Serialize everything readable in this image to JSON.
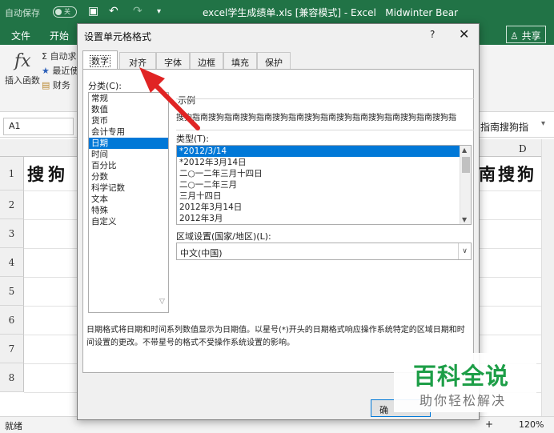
{
  "excel": {
    "autosave_label": "自动保存",
    "autosave_state": "关",
    "window_title": "excel学生成绩单.xls  [兼容模式]  -  Excel",
    "user_name": "Midwinter Bear",
    "ribbon_tabs": [
      "文件",
      "开始"
    ],
    "share_label": "共享",
    "insert_function_label": "插入函数",
    "autosum_label": "自动求",
    "recent_label": "最近使",
    "finance_label": "财务",
    "name_box_value": "A1",
    "formula_right_text": "指南搜狗指",
    "column_d": "D",
    "row_numbers": [
      "1",
      "2",
      "3",
      "4",
      "5",
      "6",
      "7",
      "8"
    ],
    "cell_left_text": "搜狗",
    "cell_right_text": "南搜狗",
    "status_text": "就绪",
    "zoom": "120%"
  },
  "dialog": {
    "title": "设置单元格格式",
    "help": "?",
    "close": "✕",
    "tabs": [
      "数字",
      "对齐",
      "字体",
      "边框",
      "填充",
      "保护"
    ],
    "active_tab": "数字",
    "category_label": "分类(C):",
    "categories": [
      "常规",
      "数值",
      "货币",
      "会计专用",
      "日期",
      "时间",
      "百分比",
      "分数",
      "科学记数",
      "文本",
      "特殊",
      "自定义"
    ],
    "selected_category": "日期",
    "sample_label": "示例",
    "sample_text": "搜狗指南搜狗指南搜狗指南搜狗指南搜狗指南搜狗指南搜狗指南搜狗指南搜狗指",
    "type_label": "类型(T):",
    "types": [
      "*2012/3/14",
      "*2012年3月14日",
      "二○一二年三月十四日",
      "二○一二年三月",
      "三月十四日",
      "2012年3月14日",
      "2012年3月"
    ],
    "selected_type": "*2012/3/14",
    "locale_label": "区域设置(国家/地区)(L):",
    "locale_value": "中文(中国)",
    "description": "日期格式将日期和时间系列数值显示为日期值。以星号(*)开头的日期格式响应操作系统特定的区域日期和时间设置的更改。不带星号的格式不受操作系统设置的影响。",
    "ok_label": "确"
  },
  "watermark": {
    "main": "百科全说",
    "sub": "助你轻松解决"
  },
  "colors": {
    "excel_green": "#217346",
    "selection_blue": "#0078d7",
    "arrow_red": "#e02424",
    "watermark_green": "#1d9e47"
  }
}
